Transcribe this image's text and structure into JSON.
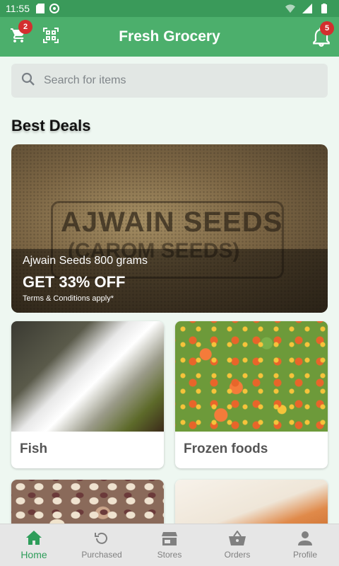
{
  "status_bar": {
    "time": "11:55"
  },
  "app_bar": {
    "title": "Fresh Grocery",
    "cart_badge": "2",
    "notification_badge": "5",
    "icons": {
      "cart": "cart-icon",
      "scan": "qr-scan-icon",
      "bell": "bell-icon"
    }
  },
  "search": {
    "placeholder": "Search for items",
    "value": ""
  },
  "section": {
    "title": "Best Deals"
  },
  "deal": {
    "pack_text_line1": "AJWAIN SEEDS",
    "pack_text_line2": "(CAROM SEEDS)",
    "name": "Ajwain Seeds 800 grams",
    "offer": "GET 33% OFF",
    "terms": "Terms & Conditions apply*"
  },
  "categories": [
    {
      "label": "Fish"
    },
    {
      "label": "Frozen foods"
    },
    {
      "label": ""
    },
    {
      "label": ""
    }
  ],
  "bottom_nav": [
    {
      "label": "Home",
      "icon": "home-icon",
      "active": true
    },
    {
      "label": "Purchased",
      "icon": "history-icon",
      "active": false
    },
    {
      "label": "Stores",
      "icon": "store-icon",
      "active": false
    },
    {
      "label": "Orders",
      "icon": "basket-icon",
      "active": false
    },
    {
      "label": "Profile",
      "icon": "person-icon",
      "active": false
    }
  ],
  "colors": {
    "primary": "#4caf6c",
    "status_bar": "#3a9a5a",
    "accent_nav": "#2e9d5a",
    "badge": "#d32f2f"
  }
}
